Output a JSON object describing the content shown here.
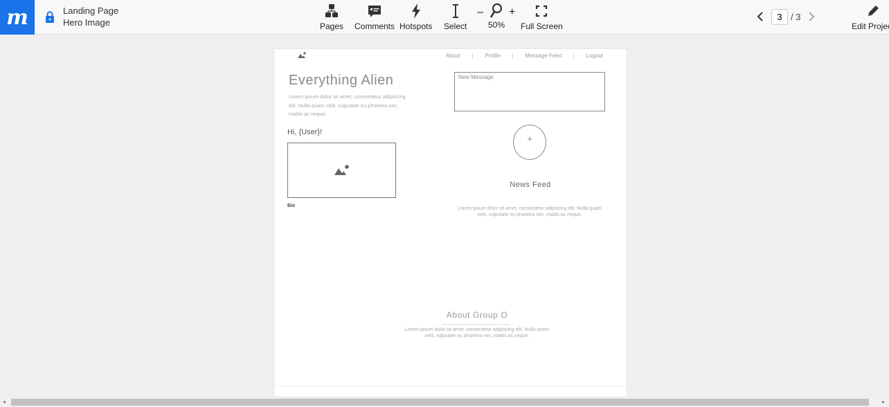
{
  "app": {
    "logo_letter": "m",
    "brand_color": "#1a73e8",
    "project_name": "Landing Page",
    "screen_name": "Hero Image"
  },
  "toolbar": {
    "pages_label": "Pages",
    "comments_label": "Comments",
    "hotspots_label": "Hotspots",
    "select_label": "Select",
    "zoom_minus": "–",
    "zoom_plus": "+",
    "zoom_value": "50%",
    "fullscreen_label": "Full Screen",
    "edit_label": "Edit Project"
  },
  "pager": {
    "current": "3",
    "total": "/ 3"
  },
  "mockup": {
    "nav": {
      "about": "About",
      "profile": "Profile",
      "message_feed": "Message Feed",
      "logout": "Logout",
      "separator": "|"
    },
    "hero_title": "Everything Alien",
    "hero_text": "Lorem ipsum dolor sit amet, consectetur adipiscing elit. Nulla quam velit, vulputate eu pharetra nec, mattis ac neque.",
    "greeting": "Hi, {User}!",
    "bio_label": "Bio",
    "message_placeholder": "New Message",
    "plus_symbol": "+",
    "news_feed_title": "News Feed",
    "news_feed_text": "Lorem ipsum dolor sit amet, consectetur adipiscing elit. Nulla quam velit, vulputate eu pharetra nec, mattis ac neque.",
    "about_title": "About Group O",
    "about_text": "Lorem ipsum dolor sit amet, consectetur adipiscing elit. Nulla quam velit, vulputate eu pharetra nec, mattis ac neque."
  }
}
